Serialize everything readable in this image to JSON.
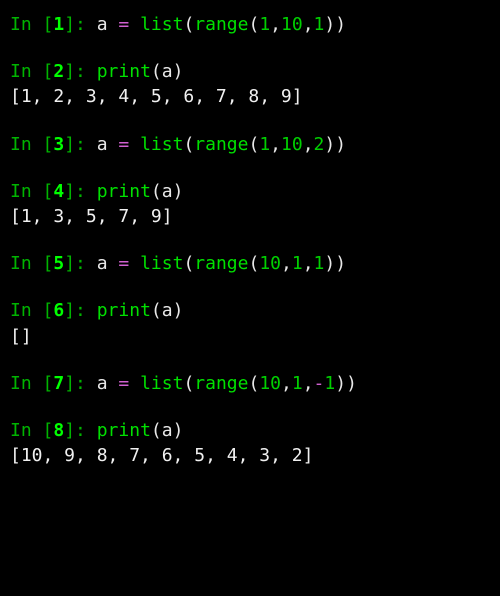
{
  "cells": [
    {
      "n": "1",
      "tokens": [
        {
          "t": "a ",
          "cls": "var"
        },
        {
          "t": "=",
          "cls": "op"
        },
        {
          "t": " ",
          "cls": "var"
        },
        {
          "t": "list",
          "cls": "fn"
        },
        {
          "t": "(",
          "cls": "paren"
        },
        {
          "t": "range",
          "cls": "fn"
        },
        {
          "t": "(",
          "cls": "paren"
        },
        {
          "t": "1",
          "cls": "num"
        },
        {
          "t": ",",
          "cls": "comma"
        },
        {
          "t": "10",
          "cls": "num"
        },
        {
          "t": ",",
          "cls": "comma"
        },
        {
          "t": "1",
          "cls": "num"
        },
        {
          "t": "))",
          "cls": "paren"
        }
      ],
      "output": null
    },
    {
      "n": "2",
      "tokens": [
        {
          "t": "print",
          "cls": "fn"
        },
        {
          "t": "(",
          "cls": "paren"
        },
        {
          "t": "a",
          "cls": "var"
        },
        {
          "t": ")",
          "cls": "paren"
        }
      ],
      "output": "[1, 2, 3, 4, 5, 6, 7, 8, 9]"
    },
    {
      "n": "3",
      "tokens": [
        {
          "t": "a ",
          "cls": "var"
        },
        {
          "t": "=",
          "cls": "op"
        },
        {
          "t": " ",
          "cls": "var"
        },
        {
          "t": "list",
          "cls": "fn"
        },
        {
          "t": "(",
          "cls": "paren"
        },
        {
          "t": "range",
          "cls": "fn"
        },
        {
          "t": "(",
          "cls": "paren"
        },
        {
          "t": "1",
          "cls": "num"
        },
        {
          "t": ",",
          "cls": "comma"
        },
        {
          "t": "10",
          "cls": "num"
        },
        {
          "t": ",",
          "cls": "comma"
        },
        {
          "t": "2",
          "cls": "num"
        },
        {
          "t": "))",
          "cls": "paren"
        }
      ],
      "output": null
    },
    {
      "n": "4",
      "tokens": [
        {
          "t": "print",
          "cls": "fn"
        },
        {
          "t": "(",
          "cls": "paren"
        },
        {
          "t": "a",
          "cls": "var"
        },
        {
          "t": ")",
          "cls": "paren"
        }
      ],
      "output": "[1, 3, 5, 7, 9]"
    },
    {
      "n": "5",
      "tokens": [
        {
          "t": "a ",
          "cls": "var"
        },
        {
          "t": "=",
          "cls": "op"
        },
        {
          "t": " ",
          "cls": "var"
        },
        {
          "t": "list",
          "cls": "fn"
        },
        {
          "t": "(",
          "cls": "paren"
        },
        {
          "t": "range",
          "cls": "fn"
        },
        {
          "t": "(",
          "cls": "paren"
        },
        {
          "t": "10",
          "cls": "num"
        },
        {
          "t": ",",
          "cls": "comma"
        },
        {
          "t": "1",
          "cls": "num"
        },
        {
          "t": ",",
          "cls": "comma"
        },
        {
          "t": "1",
          "cls": "num"
        },
        {
          "t": "))",
          "cls": "paren"
        }
      ],
      "output": null
    },
    {
      "n": "6",
      "tokens": [
        {
          "t": "print",
          "cls": "fn"
        },
        {
          "t": "(",
          "cls": "paren"
        },
        {
          "t": "a",
          "cls": "var"
        },
        {
          "t": ")",
          "cls": "paren"
        }
      ],
      "output": "[]"
    },
    {
      "n": "7",
      "tokens": [
        {
          "t": "a ",
          "cls": "var"
        },
        {
          "t": "=",
          "cls": "op"
        },
        {
          "t": " ",
          "cls": "var"
        },
        {
          "t": "list",
          "cls": "fn"
        },
        {
          "t": "(",
          "cls": "paren"
        },
        {
          "t": "range",
          "cls": "fn"
        },
        {
          "t": "(",
          "cls": "paren"
        },
        {
          "t": "10",
          "cls": "num"
        },
        {
          "t": ",",
          "cls": "comma"
        },
        {
          "t": "1",
          "cls": "num"
        },
        {
          "t": ",",
          "cls": "comma"
        },
        {
          "t": "-",
          "cls": "op"
        },
        {
          "t": "1",
          "cls": "num"
        },
        {
          "t": "))",
          "cls": "paren"
        }
      ],
      "output": null
    },
    {
      "n": "8",
      "tokens": [
        {
          "t": "print",
          "cls": "fn"
        },
        {
          "t": "(",
          "cls": "paren"
        },
        {
          "t": "a",
          "cls": "var"
        },
        {
          "t": ")",
          "cls": "paren"
        }
      ],
      "output": "[10, 9, 8, 7, 6, 5, 4, 3, 2]"
    }
  ],
  "prompt_prefix": "In [",
  "prompt_suffix": "]: "
}
